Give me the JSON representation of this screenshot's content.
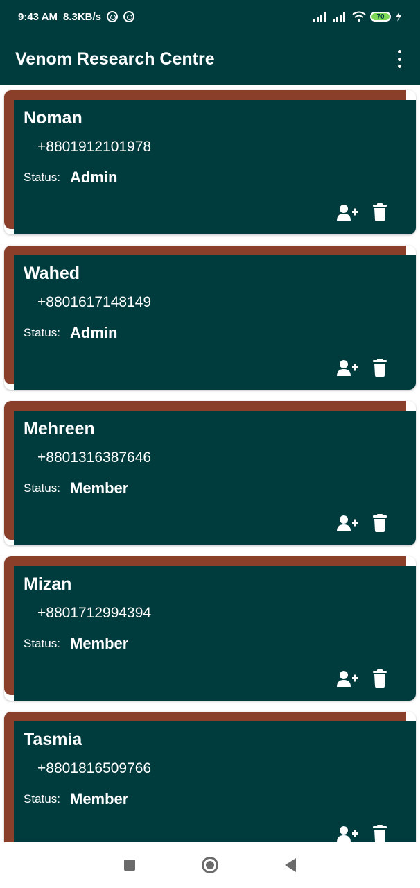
{
  "statusbar": {
    "time": "9:43 AM",
    "speed": "8.3KB/s",
    "battery": "70"
  },
  "appbar": {
    "title": "Venom Research Centre"
  },
  "colors": {
    "primary": "#003b3d",
    "accent": "#8a3f2b"
  },
  "members": [
    {
      "name": "Noman",
      "phone": "+8801912101978",
      "status_label": "Status:",
      "status": "Admin"
    },
    {
      "name": "Wahed",
      "phone": "+8801617148149",
      "status_label": "Status:",
      "status": "Admin"
    },
    {
      "name": "Mehreen",
      "phone": "+8801316387646",
      "status_label": "Status:",
      "status": "Member"
    },
    {
      "name": "Mizan",
      "phone": "+8801712994394",
      "status_label": "Status:",
      "status": "Member"
    },
    {
      "name": "Tasmia",
      "phone": "+8801816509766",
      "status_label": "Status:",
      "status": "Member"
    }
  ]
}
